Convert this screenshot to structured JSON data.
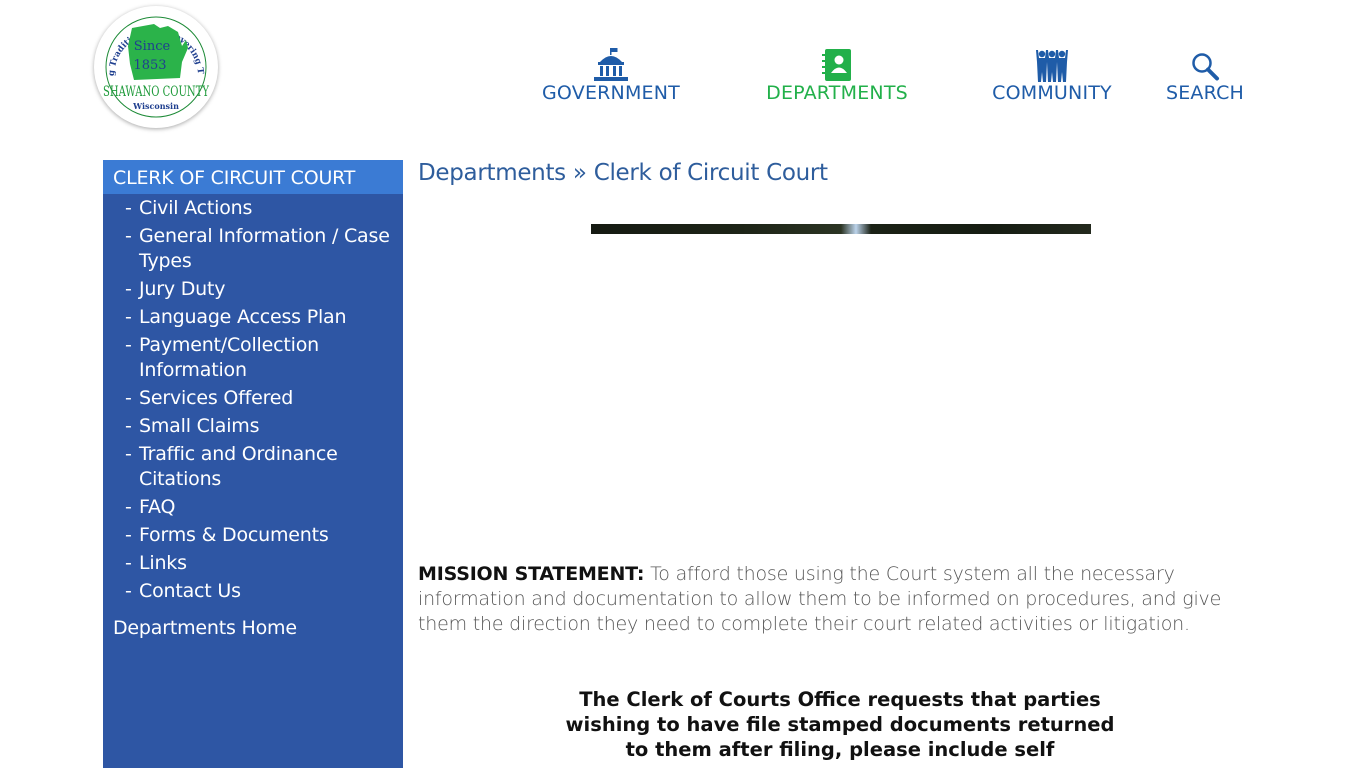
{
  "logo": {
    "arc_text": "Honoring Tradition • Discovering Tomorrow",
    "since": "Since",
    "year": "1853",
    "county": "SHAWANO COUNTY",
    "state": "Wisconsin"
  },
  "nav": [
    {
      "label": "GOVERNMENT",
      "icon": "capitol-building-icon",
      "color": "#1f5ca8"
    },
    {
      "label": "DEPARTMENTS",
      "icon": "address-book-icon",
      "color": "#22b04a",
      "active": true
    },
    {
      "label": "COMMUNITY",
      "icon": "people-group-icon",
      "color": "#1f5ca8"
    },
    {
      "label": "SEARCH",
      "icon": "magnifier-icon",
      "color": "#1f5ca8"
    }
  ],
  "sidebar": {
    "heading": "CLERK OF CIRCUIT COURT",
    "items": [
      {
        "label": "Civil Actions"
      },
      {
        "label": "General Information / Case Types"
      },
      {
        "label": "Jury Duty"
      },
      {
        "label": "Language Access Plan"
      },
      {
        "label": "Payment/Collection Information"
      },
      {
        "label": "Services Offered"
      },
      {
        "label": "Small Claims"
      },
      {
        "label": "Traffic and Ordinance Citations"
      },
      {
        "label": "FAQ"
      },
      {
        "label": "Forms & Documents"
      },
      {
        "label": "Links"
      },
      {
        "label": "Contact Us"
      }
    ],
    "dash": "-",
    "home_link": "Departments Home"
  },
  "breadcrumb": {
    "parent": "Departments",
    "separator": "»",
    "current": "Clerk of Circuit Court"
  },
  "mission": {
    "label": "MISSION STATEMENT:",
    "text": "To afford those using the Court system all the necessary information and documentation to allow them to be informed on procedures, and give them the direction they need to complete their court related activities or litigation."
  },
  "notice": {
    "text": "The Clerk of Courts Office requests that parties wishing to have file stamped documents returned to them after filing, please include self"
  },
  "colors": {
    "brand_blue": "#1f5ca8",
    "brand_green": "#22b04a",
    "sidebar_bg": "#2e56a4",
    "sidebar_head": "#3b7bd4"
  }
}
